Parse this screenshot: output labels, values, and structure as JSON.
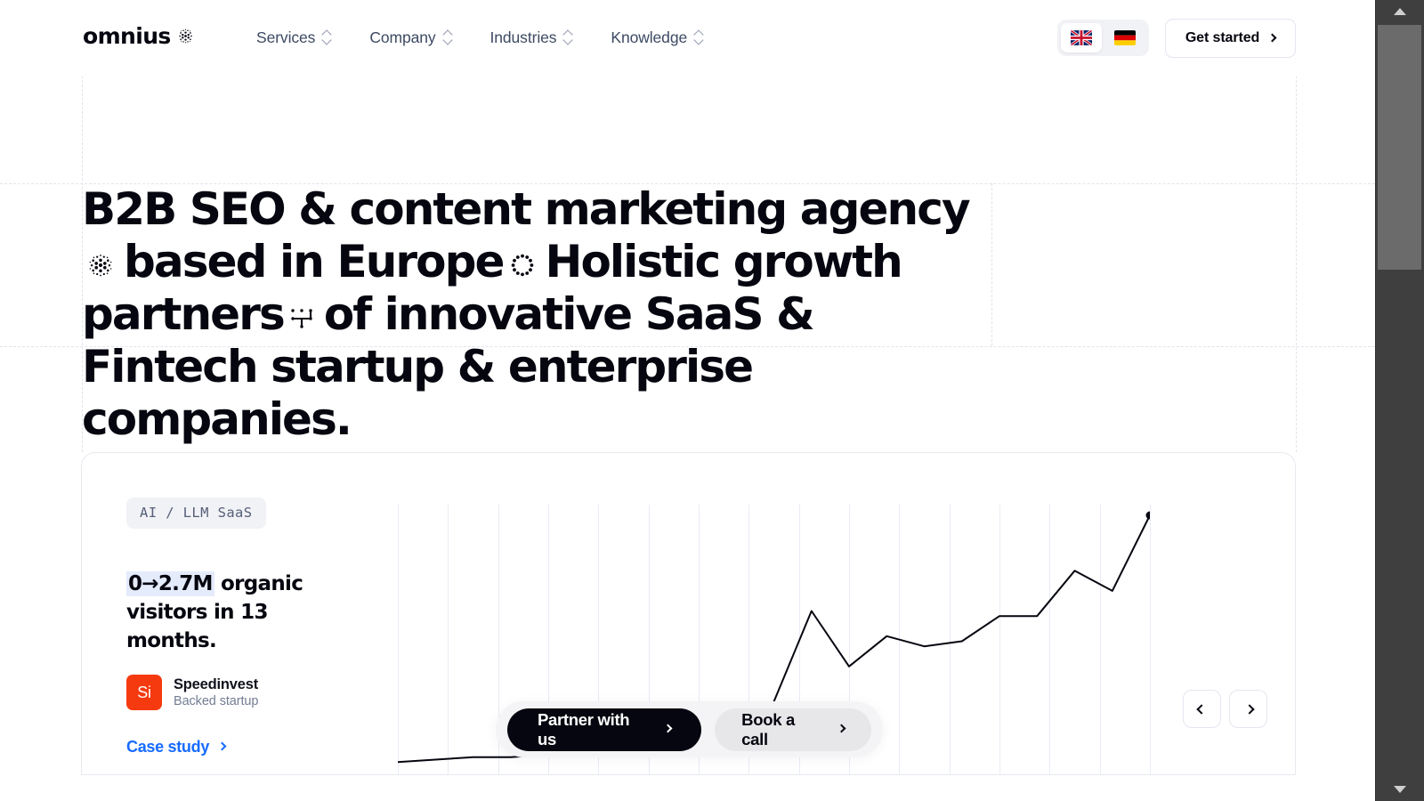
{
  "brand": {
    "logo_text": "omnius",
    "logo_icon": "dot-sphere-icon",
    "accent_blue": "#176bff",
    "investor_color": "#f63a0f",
    "highlight_color": "#e4ebfb"
  },
  "header": {
    "nav": [
      {
        "label": "Services",
        "icon": "chevron-up-down-icon"
      },
      {
        "label": "Company",
        "icon": "chevron-up-down-icon"
      },
      {
        "label": "Industries",
        "icon": "chevron-up-down-icon"
      },
      {
        "label": "Knowledge",
        "icon": "chevron-up-down-icon"
      }
    ],
    "languages": [
      {
        "code": "en",
        "name": "english-flag",
        "selected": true
      },
      {
        "code": "de",
        "name": "german-flag",
        "selected": false
      }
    ],
    "cta": {
      "label": "Get started",
      "icon": "chevron-right-icon"
    }
  },
  "hero": {
    "line1_a": "B2B SEO & content marketing agency",
    "icon1": "dot-sphere-icon",
    "line1_b": "based in",
    "line2_a": "Europe",
    "icon2": "eu-stars-icon",
    "line2_b": "Holistic growth partners",
    "icon3": "dotted-growth-grid-icon",
    "line2_c": "of innovative",
    "line3": "SaaS & Fintech startup & enterprise companies."
  },
  "case_card": {
    "badge": "AI / LLM SaaS",
    "stat_highlight": "0→2.7M",
    "stat_rest": " organic visitors in 13 months.",
    "investor": {
      "logo_initials": "Si",
      "name": "Speedinvest",
      "subtitle": "Backed startup"
    },
    "link": {
      "label": "Case study",
      "icon": "chevron-right-icon"
    }
  },
  "chart_data": {
    "type": "line",
    "title": "Organic visitors growth",
    "xlabel": "",
    "ylabel": "",
    "grid": true,
    "gridline_count": 16,
    "legend": "none",
    "x": [
      0,
      1,
      2,
      3,
      4,
      5,
      6,
      7,
      8,
      9,
      10,
      11,
      12,
      13,
      14,
      15,
      16,
      17,
      18,
      19,
      20
    ],
    "values": [
      2,
      3,
      4,
      4,
      5,
      5,
      6,
      7,
      8,
      10,
      26,
      62,
      40,
      52,
      48,
      50,
      60,
      60,
      78,
      70,
      100
    ],
    "ylim": [
      0,
      100
    ],
    "xlim": [
      0,
      20
    ],
    "end_marker": true,
    "line_color": "#05060f",
    "gridline_color": "#e9ecf5"
  },
  "cta_float": {
    "primary": {
      "label": "Partner with us",
      "icon": "chevron-right-icon"
    },
    "secondary": {
      "label": "Book a call",
      "icon": "chevron-right-icon"
    }
  },
  "carousel": {
    "prev": {
      "name": "previous-slide",
      "icon": "chevron-left-icon"
    },
    "next": {
      "name": "next-slide",
      "icon": "chevron-right-icon"
    }
  },
  "scrollbar": {
    "up_icon": "triangle-up-icon",
    "down_icon": "triangle-down-icon"
  }
}
